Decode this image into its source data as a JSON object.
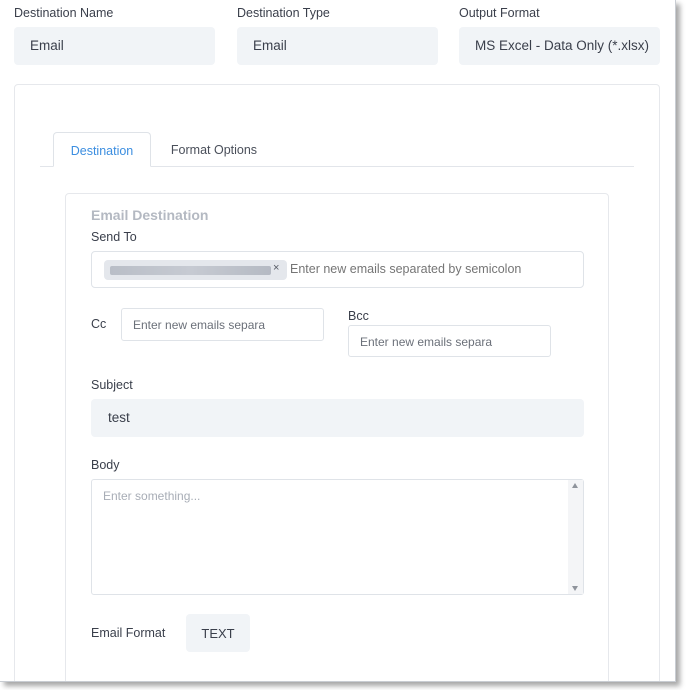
{
  "top_fields": [
    {
      "label": "Destination Name",
      "value": "Email"
    },
    {
      "label": "Destination Type",
      "value": "Email"
    },
    {
      "label": "Output Format",
      "value": "MS Excel - Data Only (*.xlsx)"
    }
  ],
  "tabs": [
    {
      "label": "Destination",
      "active": true
    },
    {
      "label": "Format Options",
      "active": false
    }
  ],
  "email_destination": {
    "section_title": "Email Destination",
    "send_to": {
      "label": "Send To",
      "chip_remove": "×",
      "placeholder": "Enter new emails separated by semicolon"
    },
    "cc": {
      "label": "Cc",
      "placeholder": "Enter new emails separa"
    },
    "bcc": {
      "label": "Bcc",
      "placeholder": "Enter new emails separa"
    },
    "subject": {
      "label": "Subject",
      "value": "test"
    },
    "body": {
      "label": "Body",
      "placeholder": "Enter something..."
    },
    "email_format": {
      "label": "Email Format",
      "value": "TEXT"
    }
  },
  "colors": {
    "accent": "#3c8ee0",
    "field_bg": "#f1f4f7",
    "border": "#dfe3e8"
  }
}
